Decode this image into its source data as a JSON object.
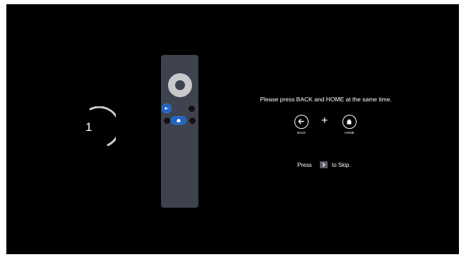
{
  "countdown": {
    "value": "1"
  },
  "remote": {
    "highlighted_buttons": [
      "back",
      "home"
    ],
    "highlight_color": "#1e63c4",
    "body_color": "#3f424f"
  },
  "instruction": {
    "text": "Please press BACK and HOME at the same time.",
    "plus": "+",
    "back_key": {
      "icon": "arrow-left-icon",
      "label": "BACK"
    },
    "home_key": {
      "icon": "home-icon",
      "label": "HOME"
    }
  },
  "skip": {
    "before": "Press",
    "key_icon": "chevron-right-icon",
    "after": "to Skip."
  }
}
